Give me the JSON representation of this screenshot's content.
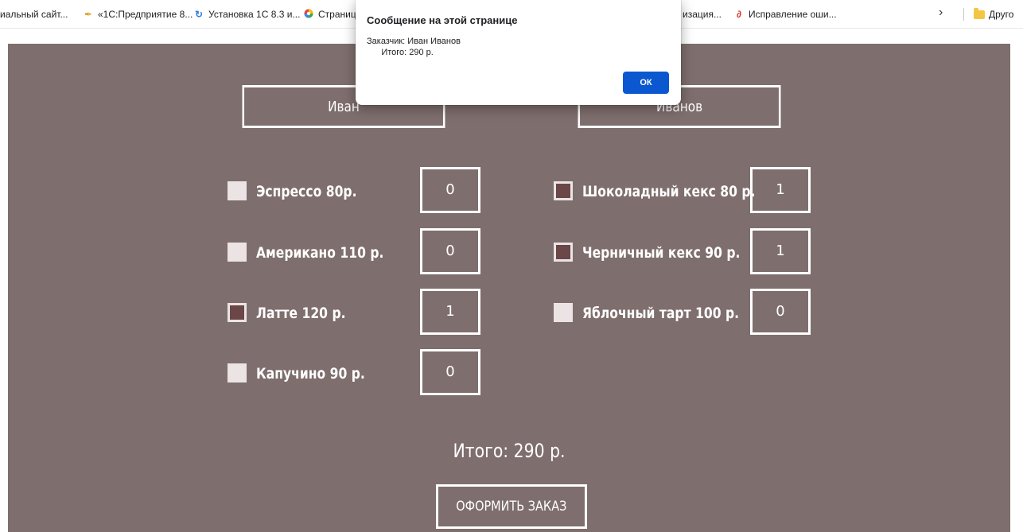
{
  "bookmarks": {
    "items": [
      {
        "label": "иальный сайт...",
        "icon": "none"
      },
      {
        "label": "«1С:Предприятие 8...",
        "icon": "1c-logo-icon"
      },
      {
        "label": "Установка 1С 8.3 и...",
        "icon": "refresh-c-icon"
      },
      {
        "label": "Страниц",
        "icon": "colorful-logo-icon"
      },
      {
        "label": "изация...",
        "icon": "none"
      },
      {
        "label": "Исправление оши...",
        "icon": "paperclip-icon"
      }
    ],
    "more_chevron": "›",
    "other_folder": "Друго"
  },
  "dialog": {
    "title": "Сообщение на этой странице",
    "message": "Заказчик: Иван Иванов\n      Итого: 290 р.",
    "ok_label": "ОК"
  },
  "form": {
    "first_name": "Иван",
    "last_name": "Иванов"
  },
  "menu": {
    "left": [
      {
        "label": "Эспрессо 80р.",
        "checked": false,
        "qty": "0"
      },
      {
        "label": "Американо 110 р.",
        "checked": false,
        "qty": "0"
      },
      {
        "label": "Латте 120 р.",
        "checked": true,
        "qty": "1"
      },
      {
        "label": "Капучино 90 р.",
        "checked": false,
        "qty": "0"
      }
    ],
    "right": [
      {
        "label": "Шоколадный кекс 80 р.",
        "checked": true,
        "qty": "1"
      },
      {
        "label": "Черничный кекс 90 р.",
        "checked": true,
        "qty": "1"
      },
      {
        "label": "Яблочный тарт 100 р.",
        "checked": false,
        "qty": "0"
      }
    ]
  },
  "total": "Итого: 290 р.",
  "order_button": "ОФОРМИТЬ ЗАКАЗ",
  "colors": {
    "page_bg": "#7e6e6d",
    "checkbox_checked": "#6b4747",
    "checkbox_unchecked": "#ece4e4",
    "dialog_ok": "#0b57d0"
  }
}
